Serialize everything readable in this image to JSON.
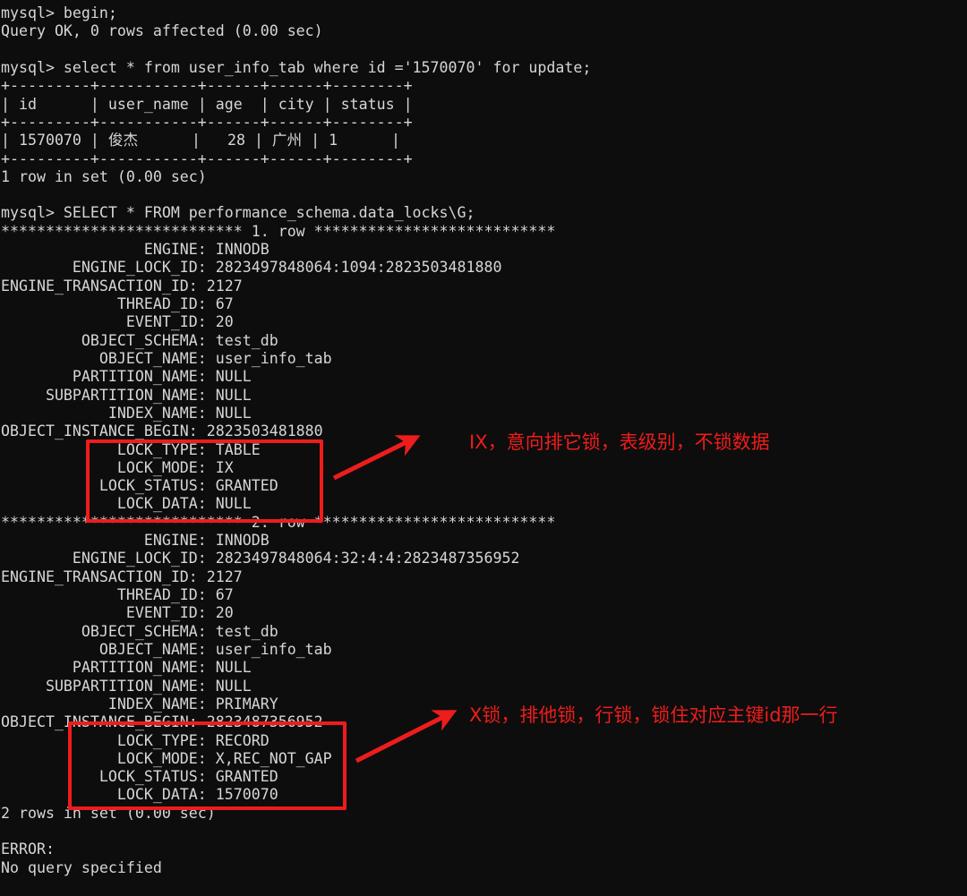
{
  "terminal": {
    "background_color": "#0d0d0d",
    "text_color": "#d6d6d6",
    "annotation_color": "#ef1c1c",
    "console_text": "mysql> begin;\nQuery OK, 0 rows affected (0.00 sec)\n\nmysql> select * from user_info_tab where id ='1570070' for update;\n+---------+-----------+------+------+--------+\n| id      | user_name | age  | city | status |\n+---------+-----------+------+------+--------+\n| 1570070 | 俊杰      |   28 | 广州 | 1      |\n+---------+-----------+------+------+--------+\n1 row in set (0.00 sec)\n\nmysql> SELECT * FROM performance_schema.data_locks\\G;\n*************************** 1. row ***************************\n                ENGINE: INNODB\n        ENGINE_LOCK_ID: 2823497848064:1094:2823503481880\nENGINE_TRANSACTION_ID: 2127\n             THREAD_ID: 67\n              EVENT_ID: 20\n         OBJECT_SCHEMA: test_db\n           OBJECT_NAME: user_info_tab\n        PARTITION_NAME: NULL\n     SUBPARTITION_NAME: NULL\n            INDEX_NAME: NULL\nOBJECT_INSTANCE_BEGIN: 2823503481880\n             LOCK_TYPE: TABLE\n             LOCK_MODE: IX\n           LOCK_STATUS: GRANTED\n             LOCK_DATA: NULL\n*************************** 2. row ***************************\n                ENGINE: INNODB\n        ENGINE_LOCK_ID: 2823497848064:32:4:4:2823487356952\nENGINE_TRANSACTION_ID: 2127\n             THREAD_ID: 67\n              EVENT_ID: 20\n         OBJECT_SCHEMA: test_db\n           OBJECT_NAME: user_info_tab\n        PARTITION_NAME: NULL\n     SUBPARTITION_NAME: NULL\n            INDEX_NAME: PRIMARY\nOBJECT_INSTANCE_BEGIN: 2823487356952\n             LOCK_TYPE: RECORD\n             LOCK_MODE: X,REC_NOT_GAP\n           LOCK_STATUS: GRANTED\n             LOCK_DATA: 1570070\n2 rows in set (0.00 sec)\n\nERROR:\nNo query specified"
  },
  "commands": [
    {
      "prompt": "mysql>",
      "text": "begin;"
    },
    {
      "prompt": "mysql>",
      "text": "select * from user_info_tab where id ='1570070' for update;"
    },
    {
      "prompt": "mysql>",
      "text": "SELECT * FROM performance_schema.data_locks\\G;"
    }
  ],
  "result_table": {
    "columns": [
      "id",
      "user_name",
      "age",
      "city",
      "status"
    ],
    "rows": [
      [
        "1570070",
        "俊杰",
        "28",
        "广州",
        "1"
      ]
    ],
    "footer": "1 row in set (0.00 sec)"
  },
  "lock_rows": [
    {
      "row_header": "*************************** 1. row ***************************",
      "fields": {
        "ENGINE": "INNODB",
        "ENGINE_LOCK_ID": "2823497848064:1094:2823503481880",
        "ENGINE_TRANSACTION_ID": "2127",
        "THREAD_ID": "67",
        "EVENT_ID": "20",
        "OBJECT_SCHEMA": "test_db",
        "OBJECT_NAME": "user_info_tab",
        "PARTITION_NAME": "NULL",
        "SUBPARTITION_NAME": "NULL",
        "INDEX_NAME": "NULL",
        "OBJECT_INSTANCE_BEGIN": "2823503481880",
        "LOCK_TYPE": "TABLE",
        "LOCK_MODE": "IX",
        "LOCK_STATUS": "GRANTED",
        "LOCK_DATA": "NULL"
      }
    },
    {
      "row_header": "*************************** 2. row ***************************",
      "fields": {
        "ENGINE": "INNODB",
        "ENGINE_LOCK_ID": "2823497848064:32:4:4:2823487356952",
        "ENGINE_TRANSACTION_ID": "2127",
        "THREAD_ID": "67",
        "EVENT_ID": "20",
        "OBJECT_SCHEMA": "test_db",
        "OBJECT_NAME": "user_info_tab",
        "PARTITION_NAME": "NULL",
        "SUBPARTITION_NAME": "NULL",
        "INDEX_NAME": "PRIMARY",
        "OBJECT_INSTANCE_BEGIN": "2823487356952",
        "LOCK_TYPE": "RECORD",
        "LOCK_MODE": "X,REC_NOT_GAP",
        "LOCK_STATUS": "GRANTED",
        "LOCK_DATA": "1570070"
      }
    }
  ],
  "footers": {
    "rows_in_set": "2 rows in set (0.00 sec)",
    "error_label": "ERROR:",
    "error_message": "No query specified"
  },
  "annotations": [
    {
      "id": "ix-lock-note",
      "text": "IX，意向排它锁，表级别，不锁数据"
    },
    {
      "id": "x-lock-note",
      "text": "X锁，排他锁，行锁，锁住对应主键id那一行"
    }
  ]
}
